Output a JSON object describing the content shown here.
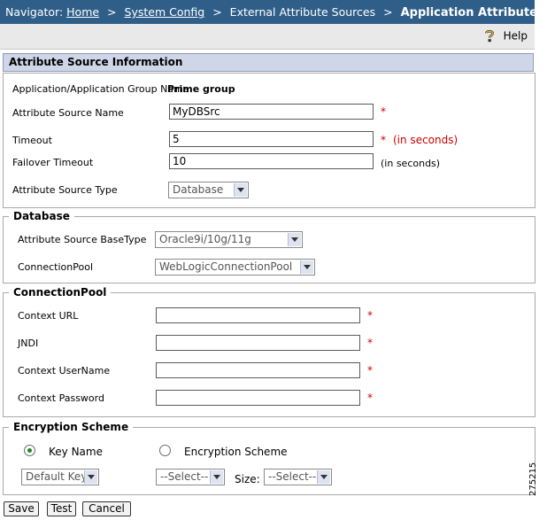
{
  "navigator": {
    "label": "Navigator:",
    "crumbs": [
      "Home",
      "System Config",
      "External Attribute Sources"
    ],
    "current": "Application Attribute Sources",
    "separator": ">"
  },
  "help": {
    "label": "Help"
  },
  "section_header": "Attribute Source Information",
  "info": {
    "app_group_label": "Application/Application Group Name",
    "app_group_value": "Prime group",
    "source_name_label": "Attribute Source Name",
    "source_name_value": "MyDBSrc",
    "timeout_label": "Timeout",
    "timeout_value": "5",
    "timeout_unit": "(in seconds)",
    "failover_label": "Failover Timeout",
    "failover_value": "10",
    "failover_unit": "(in seconds)",
    "source_type_label": "Attribute Source Type",
    "source_type_value": "Database",
    "required_mark": "*"
  },
  "database": {
    "legend": "Database",
    "basetype_label": "Attribute Source BaseType",
    "basetype_value": "Oracle9i/10g/11g",
    "pool_label": "ConnectionPool",
    "pool_value": "WebLogicConnectionPool"
  },
  "connection_pool": {
    "legend": "ConnectionPool",
    "context_url_label": "Context URL",
    "context_url_value": "",
    "jndi_label": "JNDI",
    "jndi_value": "",
    "username_label": "Context UserName",
    "username_value": "",
    "password_label": "Context Password",
    "password_value": ""
  },
  "encryption": {
    "legend": "Encryption Scheme",
    "radio_key_name": "Key Name",
    "radio_scheme": "Encryption Scheme",
    "selected": "Key Name",
    "key_select": "Default Key",
    "scheme_select": "--Select--",
    "size_label": "Size:",
    "size_select": "--Select--"
  },
  "buttons": {
    "save": "Save",
    "test": "Test",
    "cancel": "Cancel"
  },
  "figure_id": "275215",
  "colors": {
    "nav_bg": "#2f5f88",
    "required": "#cc0000",
    "header_bg": "#cfd6e8"
  },
  "icons": {
    "help": "help-question-icon"
  }
}
